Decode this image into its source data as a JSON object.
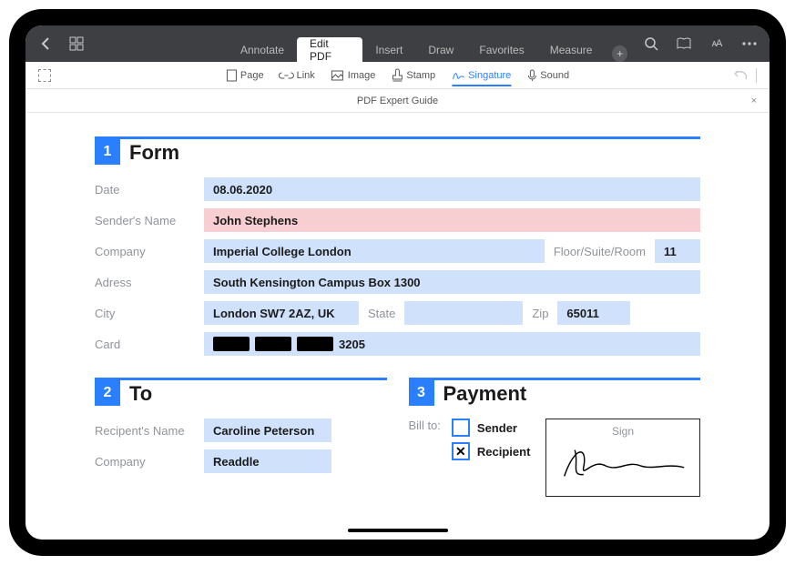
{
  "nav": {
    "tabs": [
      "Annotate",
      "Edit PDF",
      "Insert",
      "Draw",
      "Favorites",
      "Measure"
    ],
    "active": 1
  },
  "toolbar": {
    "items": [
      "Page",
      "Link",
      "Image",
      "Stamp",
      "Singature",
      "Sound"
    ],
    "active": 4
  },
  "doc": {
    "title": "PDF Expert Guide"
  },
  "section1": {
    "num": "1",
    "title": "Form"
  },
  "form": {
    "labels": {
      "date": "Date",
      "sender": "Sender's Name",
      "company": "Company",
      "floor": "Floor/Suite/Room",
      "address": "Adress",
      "city": "City",
      "state": "State",
      "zip": "Zip",
      "card": "Card"
    },
    "date": "08.06.2020",
    "sender": "John Stephens",
    "company": "Imperial College London",
    "floor": "11",
    "address": "South Kensington Campus Box 1300",
    "city": "London SW7 2AZ, UK",
    "state": "",
    "zip": "65011",
    "card_last4": "3205"
  },
  "section2": {
    "num": "2",
    "title": "To"
  },
  "to": {
    "labels": {
      "name": "Recipent's Name",
      "company": "Company"
    },
    "name": "Caroline Peterson",
    "company": "Readdle"
  },
  "section3": {
    "num": "3",
    "title": "Payment"
  },
  "payment": {
    "billto": "Bill to:",
    "sender": "Sender",
    "recipient": "Recipient",
    "sign": "Sign"
  }
}
